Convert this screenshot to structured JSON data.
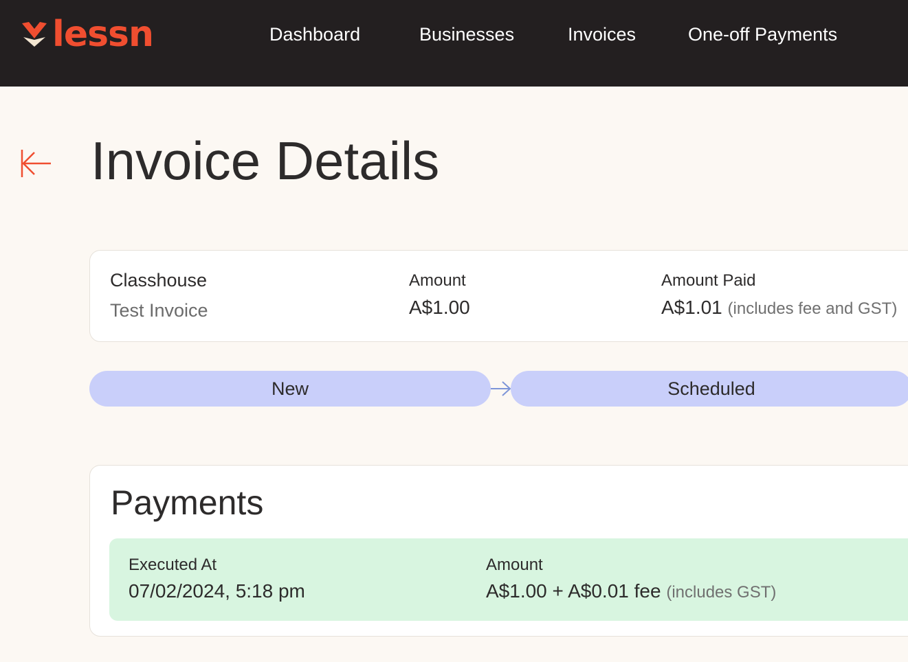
{
  "brand": {
    "name": "lessn"
  },
  "nav": {
    "items": [
      "Dashboard",
      "Businesses",
      "Invoices",
      "One-off Payments"
    ]
  },
  "page": {
    "title": "Invoice Details"
  },
  "summary": {
    "business": "Classhouse",
    "invoice_name": "Test Invoice",
    "amount_label": "Amount",
    "amount_value": "A$1.00",
    "amount_paid_label": "Amount Paid",
    "amount_paid_value": "A$1.01",
    "amount_paid_note": "(includes fee and GST)"
  },
  "statuses": [
    "New",
    "Scheduled"
  ],
  "payments": {
    "title": "Payments",
    "rows": [
      {
        "executed_label": "Executed At",
        "executed_value": "07/02/2024, 5:18 pm",
        "amount_label": "Amount",
        "amount_value": "A$1.00 + A$0.01 fee",
        "amount_note": "(includes GST)"
      }
    ]
  },
  "colors": {
    "accent": "#f04e30",
    "topbar": "#231f20",
    "background": "#fcf8f3",
    "status_pill": "#c9cffa",
    "payment_row": "#d8f5e0"
  }
}
